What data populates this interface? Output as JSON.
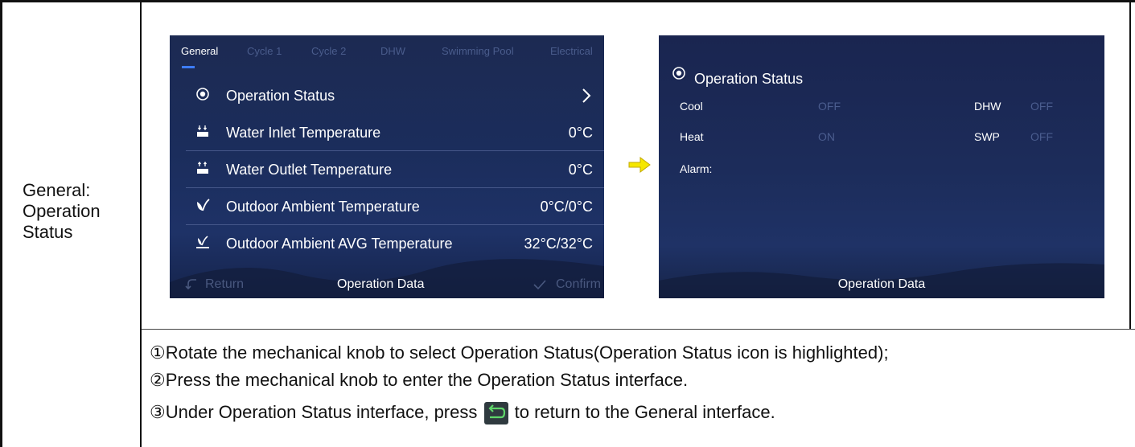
{
  "left_label": [
    "General:",
    "Operation",
    "Status"
  ],
  "screen1": {
    "tabs": [
      "General",
      "Cycle 1",
      "Cycle 2",
      "DHW",
      "Swimming Pool",
      "Electrical"
    ],
    "rows": [
      {
        "icon": "radio-target-icon",
        "label": "Operation Status",
        "value": ">"
      },
      {
        "icon": "water-inlet-icon",
        "label": "Water Inlet Temperature",
        "value": "0°C"
      },
      {
        "icon": "water-outlet-icon",
        "label": "Water Outlet Temperature",
        "value": "0°C"
      },
      {
        "icon": "leaf-icon",
        "label": "Outdoor Ambient Temperature",
        "value": "0°C/0°C"
      },
      {
        "icon": "leaf-avg-icon",
        "label": "Outdoor Ambient AVG Temperature",
        "value": "32°C/32°C"
      }
    ],
    "bottom": {
      "return": "Return",
      "title": "Operation Data",
      "confirm": "Confirm"
    }
  },
  "screen2": {
    "title": "Operation Status",
    "cool_label": "Cool",
    "cool_value": "OFF",
    "heat_label": "Heat",
    "heat_value": "ON",
    "dhw_label": "DHW",
    "dhw_value": "OFF",
    "swp_label": "SWP",
    "swp_value": "OFF",
    "alarm_label": "Alarm:",
    "bottom_title": "Operation Data"
  },
  "instructions": {
    "step1": "①Rotate the mechanical knob to select Operation Status(Operation Status icon is highlighted);",
    "step2": "②Press the mechanical knob to enter the Operation Status interface.",
    "step3_pre": "③Under Operation Status interface, press",
    "step3_post": "to return to the General interface."
  },
  "colors": {
    "accent": "#3d7cff",
    "arrow": "#f5e700"
  }
}
